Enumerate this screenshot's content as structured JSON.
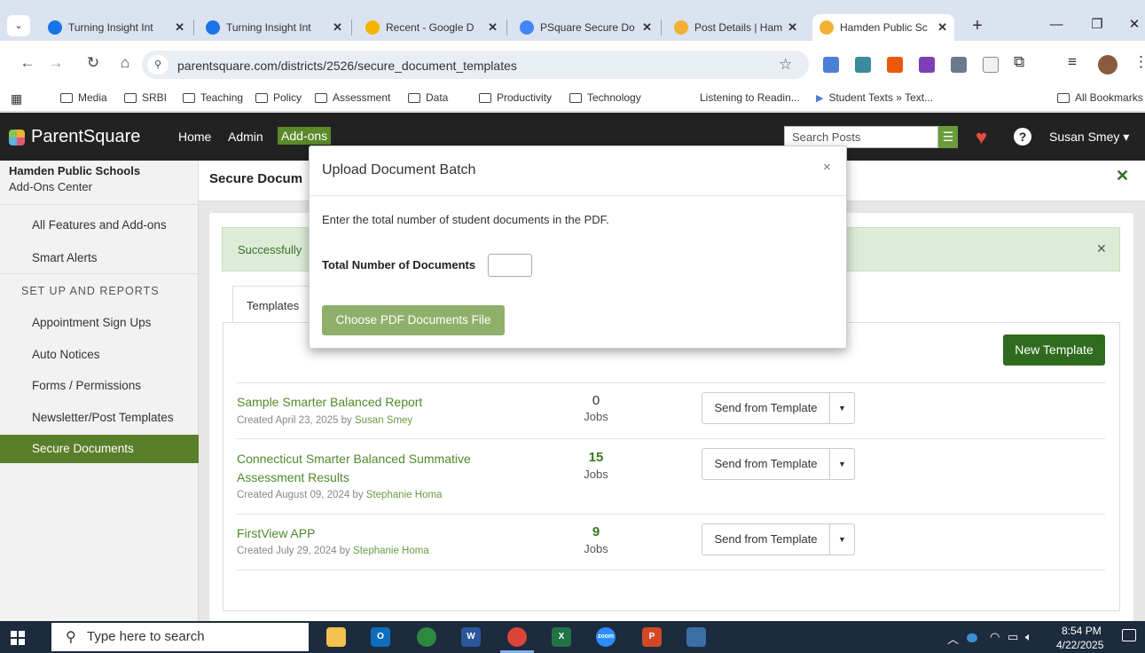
{
  "browser": {
    "tabs": [
      {
        "title": "Turning Insight Int",
        "favicon_color": "#1a73e8",
        "active": false
      },
      {
        "title": "Turning Insight Int",
        "favicon_color": "#1a73e8",
        "active": false
      },
      {
        "title": "Recent - Google D",
        "favicon_color": "#f4b400",
        "active": false
      },
      {
        "title": "PSquare Secure Do",
        "favicon_color": "#4285f4",
        "active": false
      },
      {
        "title": "Post Details | Ham",
        "favicon_color": "#f2b134",
        "active": false
      },
      {
        "title": "Hamden Public Sc",
        "favicon_color": "#f2b134",
        "active": true
      }
    ],
    "new_tab": "+",
    "url": "parentsquare.com/districts/2526/secure_document_templates",
    "bookmarks": [
      {
        "label": "Media",
        "folder": true
      },
      {
        "label": "SRBI",
        "folder": true
      },
      {
        "label": "Teaching",
        "folder": true
      },
      {
        "label": "Policy",
        "folder": true
      },
      {
        "label": "Assessment",
        "folder": true
      },
      {
        "label": "Data",
        "folder": true
      },
      {
        "label": "Productivity",
        "folder": true
      },
      {
        "label": "Technology",
        "folder": true
      },
      {
        "label": "Listening to Readin...",
        "folder": false
      },
      {
        "label": "Student Texts » Text...",
        "folder": false
      }
    ],
    "all_bookmarks": "All Bookmarks"
  },
  "app": {
    "brand": "ParentSquare",
    "nav": [
      "Home",
      "Admin",
      "Add-ons"
    ],
    "search_placeholder": "Search Posts",
    "user": "Susan Smey ▾",
    "accent": "#5a8a2a"
  },
  "sidebar": {
    "district": "Hamden Public Schools",
    "center": "Add-Ons Center",
    "top_items": [
      "All Features and Add-ons",
      "Smart Alerts"
    ],
    "heading": "SET UP AND REPORTS",
    "items": [
      "Appointment Sign Ups",
      "Auto Notices",
      "Forms / Permissions",
      "Newsletter/Post Templates",
      "Secure Documents"
    ],
    "active_item": "Secure Documents"
  },
  "page": {
    "title": "Secure Docum",
    "flash": "Successfully",
    "tab_label": "Templates",
    "new_template": "New Template",
    "templates": [
      {
        "name_lines": [
          "Sample Smarter Balanced Report"
        ],
        "created": "Created April 23, 2025 by ",
        "author": "Susan Smey",
        "jobs": "0",
        "jobs_label": "Jobs",
        "send": "Send from Template"
      },
      {
        "name_lines": [
          "Connecticut Smarter Balanced Summative",
          "Assessment Results"
        ],
        "created": "Created August 09, 2024 by ",
        "author": "Stephanie Homa",
        "jobs": "15",
        "jobs_label": "Jobs",
        "send": "Send from Template"
      },
      {
        "name_lines": [
          "FirstView APP"
        ],
        "created": "Created July 29, 2024 by ",
        "author": "Stephanie Homa",
        "jobs": "9",
        "jobs_label": "Jobs",
        "send": "Send from Template"
      }
    ]
  },
  "modal": {
    "title": "Upload Document Batch",
    "instructions": "Enter the total number of student documents in the PDF.",
    "field_label": "Total Number of Documents",
    "field_value": "",
    "button": "Choose PDF Documents File",
    "close": "×"
  },
  "taskbar": {
    "search_placeholder": "Type here to search",
    "apps": [
      {
        "icon": "file-explorer-icon",
        "color": "#f2c14e",
        "label": ""
      },
      {
        "icon": "outlook-icon",
        "color": "#0f6cbd",
        "label": "O"
      },
      {
        "icon": "chat-icon",
        "color": "#2b8a3e",
        "label": ""
      },
      {
        "icon": "word-icon",
        "color": "#2b579a",
        "label": "W"
      },
      {
        "icon": "chrome-icon",
        "color": "#db4437",
        "label": ""
      },
      {
        "icon": "excel-icon",
        "color": "#217346",
        "label": "X"
      },
      {
        "icon": "zoom-icon",
        "color": "#2d8cff",
        "label": "zoom"
      },
      {
        "icon": "powerpoint-icon",
        "color": "#d24726",
        "label": "P"
      },
      {
        "icon": "calculator-icon",
        "color": "#3b6ea5",
        "label": ""
      }
    ],
    "time": "8:54 PM",
    "date": "4/22/2025"
  }
}
